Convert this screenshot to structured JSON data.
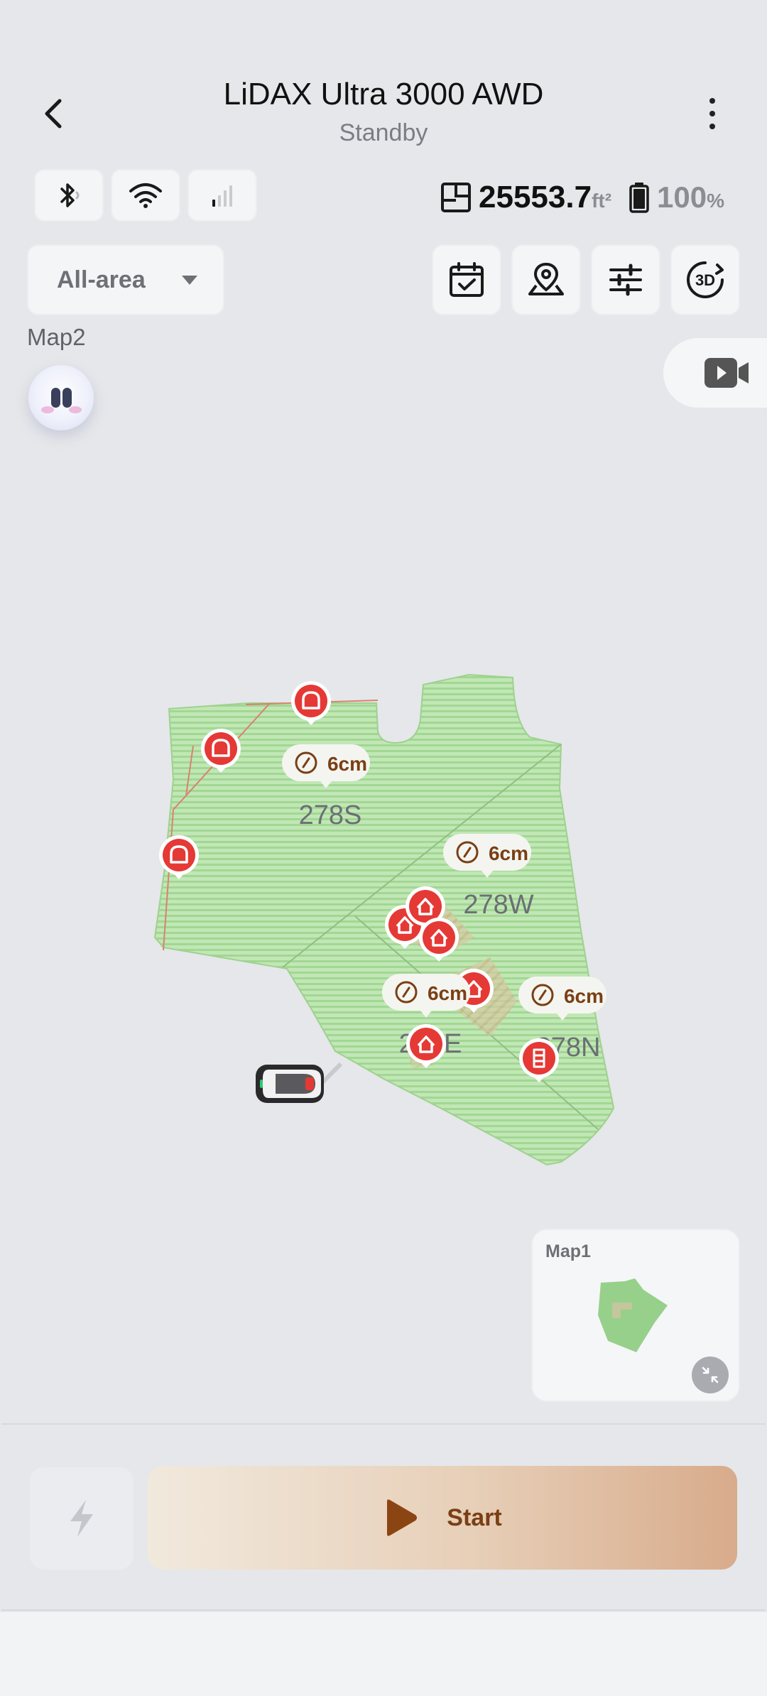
{
  "header": {
    "title": "LiDAX Ultra 3000 AWD",
    "status": "Standby"
  },
  "stats": {
    "area_value": "25553.7",
    "area_unit": "ft²",
    "battery_value": "100",
    "battery_unit": "%",
    "cellular_bars": 1
  },
  "controls": {
    "area_selector": "All-area",
    "current_map_name": "Map2",
    "toolbar": [
      "schedule-icon",
      "map-pin-icon",
      "settings-sliders-icon",
      "3d-view-icon"
    ]
  },
  "zones": [
    {
      "name": "278S",
      "height_label": "6cm"
    },
    {
      "name": "278W",
      "height_label": "6cm"
    },
    {
      "name": "278E",
      "height_label": "6cm"
    },
    {
      "name": "278N",
      "height_label": "6cm"
    }
  ],
  "mini_map": {
    "label": "Map1"
  },
  "actions": {
    "start_label": "Start"
  },
  "colors": {
    "lawn": "#bfe6b4",
    "lawn_stripe": "#a3d796",
    "marker_red": "#e53935",
    "accent_brown": "#7a3f14"
  }
}
